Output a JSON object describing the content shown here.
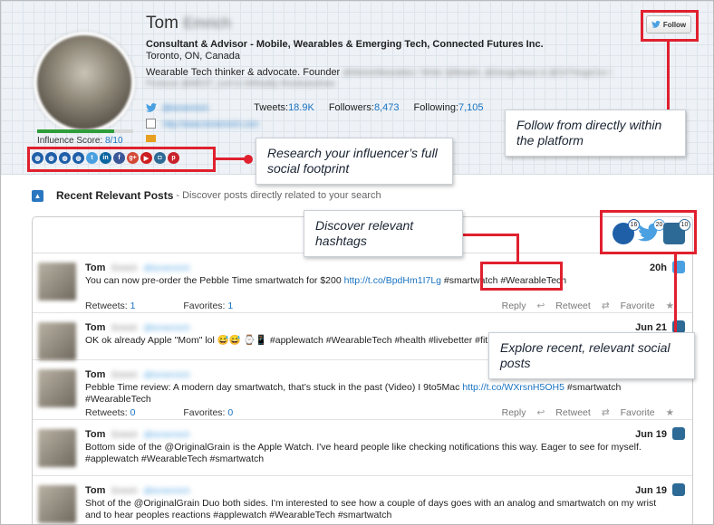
{
  "profile": {
    "first_name": "Tom",
    "last_name": "Emrich",
    "headline": "Consultant & Advisor - Mobile, Wearables & Emerging Tech, Connected Futures Inc.",
    "location": "Toronto, ON, Canada",
    "bio_start": "Wearable Tech thinker & advocate. Founder",
    "bio_rest": "@WeAreWearables / Writer @BetaKit, @DesignNews & @OnThingsCon / Producer @WEST_conf & #AReality #hooksandnew",
    "twitter_handle": "@tomemrich",
    "tweets_label": "Tweets:",
    "tweets": "18.9K",
    "followers_label": "Followers:",
    "followers": "8,473",
    "following_label": "Following:",
    "following": "7,105",
    "website": "http://www.tomemrich.com",
    "influence_label": "Influence Score:",
    "influence_score": "8/10",
    "influence_fraction": 0.8,
    "follow_label": "Follow"
  },
  "social_icons": [
    "globe-icon",
    "globe-icon",
    "globe-icon",
    "globe-icon",
    "twitter-icon",
    "linkedin-icon",
    "facebook-icon",
    "google-plus-icon",
    "youtube-icon",
    "instagram-icon",
    "pinterest-icon"
  ],
  "callouts": {
    "follow": "Follow from directly within the platform",
    "research": "Research your influencer’s full social footprint",
    "hashtags": "Discover relevant hashtags",
    "explore": "Explore recent, relevant social posts"
  },
  "section": {
    "title": "Recent Relevant Posts",
    "subtitle": "- Discover posts directly related to your search"
  },
  "network_filters": [
    {
      "icon": "globe-icon",
      "count": "16"
    },
    {
      "icon": "twitter-icon",
      "count": "20"
    },
    {
      "icon": "instagram-icon",
      "count": "10"
    }
  ],
  "posts": [
    {
      "author": "Tom",
      "author_last": "Emrich",
      "handle": "@tomemrich",
      "text": "You can now pre-order the Pebble Time smartwatch for $200 ",
      "link": "http://t.co/BpdHm1I7Lg",
      "tags": " #smartwatch #WearableTech",
      "date": "20h",
      "network": "twitter",
      "retweets_label": "Retweets:",
      "retweets": "1",
      "favorites_label": "Favorites:",
      "favorites": "1"
    },
    {
      "author": "Tom",
      "author_last": "Emrich",
      "handle": "@tomemrich",
      "text": "OK ok already Apple \"Mom\" lol 😅😅 ⌚📱 #applewatch #WearableTech #health #livebetter #fitness #smar",
      "date": "Jun 21",
      "network": "instagram"
    },
    {
      "author": "Tom",
      "author_last": "Emrich",
      "handle": "@tomemrich",
      "text": "Pebble Time review: A modern day smartwatch, that’s stuck in the past (Video) I 9to5Mac ",
      "link": "http://t.co/WXrsnH5OH5",
      "tags": " #smartwatch #WearableTech",
      "date": "",
      "network": "twitter",
      "retweets_label": "Retweets:",
      "retweets": "0",
      "favorites_label": "Favorites:",
      "favorites": "0"
    },
    {
      "author": "Tom",
      "author_last": "Emrich",
      "handle": "@tomemrich",
      "text": "Bottom side of the @OriginalGrain is the Apple Watch. I've heard people like checking notifications this way. Eager to see for myself. #applewatch #WearableTech #smartwatch",
      "date": "Jun 19",
      "network": "instagram"
    },
    {
      "author": "Tom",
      "author_last": "Emrich",
      "handle": "@tomemrich",
      "text": "Shot of the @OriginalGrain Duo both sides. I'm interested to see how a couple of days goes with an analog and smartwatch on my wrist and to hear peoples reactions #applewatch #WearableTech #smartwatch",
      "date": "Jun 19",
      "network": "instagram"
    }
  ],
  "actions": {
    "reply": "Reply",
    "retweet": "Retweet",
    "favorite": "Favorite"
  }
}
